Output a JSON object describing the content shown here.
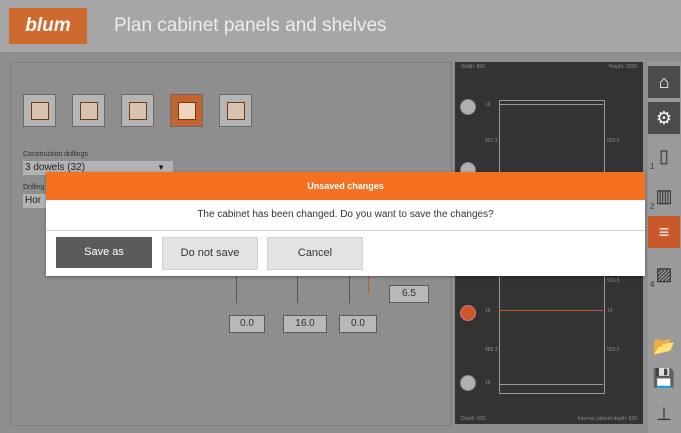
{
  "app": {
    "logo": "blum",
    "title": "Plan cabinet panels and shelves"
  },
  "form": {
    "construction_label": "Construction drillings",
    "construction_value": "3 dowels (32)",
    "drilling_label": "Drilling",
    "drilling_value": "Hor"
  },
  "values": {
    "v1": "0.0",
    "v2": "16.0",
    "v3": "0.0",
    "v4": "6.5"
  },
  "preview": {
    "width_label": "Width: 800",
    "height_label": "Height: 2050",
    "depth_label": "Depth: 620",
    "internal_label": "Internal cabinet depth: 620",
    "dims": [
      "16",
      "497.3",
      "503.5",
      "16",
      "503.5",
      "16",
      "489.3",
      "503.5",
      "16"
    ]
  },
  "toolbar": {
    "nums": [
      "1",
      "2",
      "4"
    ]
  },
  "dialog": {
    "title": "Unsaved changes",
    "message": "The cabinet has been changed. Do you want to save the changes?",
    "save_as": "Save as",
    "do_not_save": "Do not save",
    "cancel": "Cancel"
  }
}
